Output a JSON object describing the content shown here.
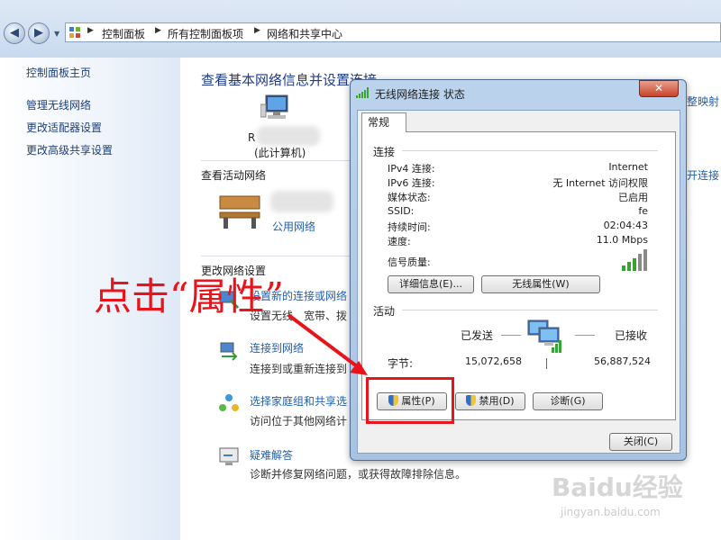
{
  "breadcrumb": [
    "控制面板",
    "所有控制面板项",
    "网络和共享中心"
  ],
  "sidebar": {
    "items": [
      {
        "label": "控制面板主页"
      },
      {
        "label": "管理无线网络"
      },
      {
        "label": "更改适配器设置"
      },
      {
        "label": "更改高级共享设置"
      }
    ]
  },
  "main": {
    "title": "查看基本网络信息并设置连接",
    "computer_label_char": "R",
    "computer_sub": "(此计算机)",
    "active_networks_heading": "查看活动网络",
    "network_type_link": "公用网络",
    "change_settings_heading": "更改网络设置",
    "right_cut_1": "整映射",
    "right_cut_2": "开连接",
    "tasks": [
      {
        "title": "设置新的连接或网络",
        "desc": "设置无线、宽带、拨"
      },
      {
        "title": "连接到网络",
        "desc": "连接到或重新连接到"
      },
      {
        "title": "选择家庭组和共享选",
        "desc": "访问位于其他网络计"
      },
      {
        "title": "疑难解答",
        "desc": "诊断并修复网络问题，或获得故障排除信息。"
      }
    ]
  },
  "dialog": {
    "title": "无线网络连接 状态",
    "close_glyph": "✕",
    "tab": "常规",
    "connection_heading": "连接",
    "rows": [
      {
        "label": "IPv4 连接:",
        "value": "Internet"
      },
      {
        "label": "IPv6 连接:",
        "value": "无 Internet 访问权限"
      },
      {
        "label": "媒体状态:",
        "value": "已启用"
      },
      {
        "label": "SSID:",
        "value": "fe"
      },
      {
        "label": "持续时间:",
        "value": "02:04:43"
      },
      {
        "label": "速度:",
        "value": "11.0 Mbps"
      }
    ],
    "signal_label": "信号质量:",
    "signal_bars_lit": 5,
    "details_button": "详细信息(E)...",
    "wireless_props_button": "无线属性(W)",
    "activity_heading": "活动",
    "sent_label": "已发送",
    "received_label": "已接收",
    "bytes_label": "字节:",
    "bytes_sent": "15,072,658",
    "bytes_received": "56,887,524",
    "properties_button": "属性(P)",
    "disable_button": "禁用(D)",
    "diagnose_button": "诊断(G)",
    "close_button": "关闭(C)"
  },
  "annotation": {
    "text": "点击“属性”",
    "color": "#e8131b"
  },
  "watermark": {
    "brand": "Baidu经验",
    "url": "jingyan.baidu.com"
  },
  "colors": {
    "link": "#1e3f7a",
    "title": "#1e3a8a",
    "accent_red": "#e8131b"
  }
}
